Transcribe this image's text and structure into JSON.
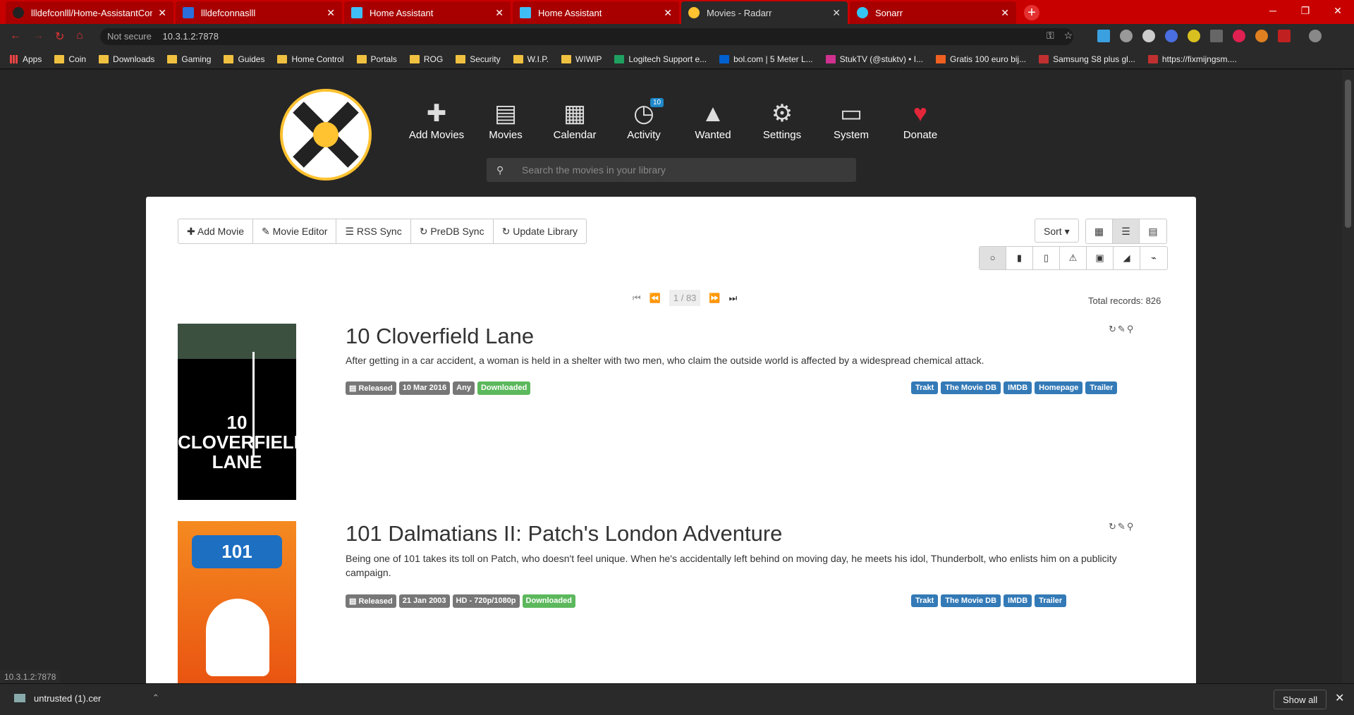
{
  "tabs": [
    {
      "title": "llldefconlll/Home-AssistantConfi",
      "favicon_color": "#222222"
    },
    {
      "title": "llldefconnaslll",
      "favicon_color": "#2a6fdb"
    },
    {
      "title": "Home Assistant",
      "favicon_color": "#41bdf5"
    },
    {
      "title": "Home Assistant",
      "favicon_color": "#41bdf5"
    },
    {
      "title": "Movies - Radarr",
      "favicon_color": "#ffc230"
    },
    {
      "title": "Sonarr",
      "favicon_color": "#35c5f4"
    }
  ],
  "browser": {
    "security": "Not secure",
    "url": "10.3.1.2:7878",
    "status_url": "10.3.1.2:7878"
  },
  "bookmarks": [
    {
      "label": "Apps",
      "kind": "apps"
    },
    {
      "label": "Coin",
      "kind": "folder"
    },
    {
      "label": "Downloads",
      "kind": "folder"
    },
    {
      "label": "Gaming",
      "kind": "folder"
    },
    {
      "label": "Guides",
      "kind": "folder"
    },
    {
      "label": "Home Control",
      "kind": "folder"
    },
    {
      "label": "Portals",
      "kind": "folder"
    },
    {
      "label": "ROG",
      "kind": "folder"
    },
    {
      "label": "Security",
      "kind": "folder"
    },
    {
      "label": "W.I.P.",
      "kind": "folder"
    },
    {
      "label": "WIWIP",
      "kind": "folder"
    },
    {
      "label": "Logitech Support e...",
      "kind": "link"
    },
    {
      "label": "bol.com | 5 Meter L...",
      "kind": "link"
    },
    {
      "label": "StukTV (@stuktv) • I...",
      "kind": "link"
    },
    {
      "label": "Gratis 100 euro bij...",
      "kind": "link"
    },
    {
      "label": "Samsung S8 plus gl...",
      "kind": "link"
    },
    {
      "label": "https://fixmijngsm....",
      "kind": "link"
    }
  ],
  "nav": [
    {
      "label": "Add Movies",
      "icon": "plus-icon",
      "glyph": "✚"
    },
    {
      "label": "Movies",
      "icon": "film-icon",
      "glyph": "🎞"
    },
    {
      "label": "Calendar",
      "icon": "calendar-icon",
      "glyph": "▦"
    },
    {
      "label": "Activity",
      "icon": "clock-icon",
      "glyph": "◷",
      "badge": "10"
    },
    {
      "label": "Wanted",
      "icon": "warning-icon",
      "glyph": "▲"
    },
    {
      "label": "Settings",
      "icon": "gears-icon",
      "glyph": "⚙"
    },
    {
      "label": "System",
      "icon": "laptop-icon",
      "glyph": "▭"
    },
    {
      "label": "Donate",
      "icon": "heart-icon",
      "glyph": "♥"
    }
  ],
  "search": {
    "placeholder": "Search the movies in your library"
  },
  "toolbar": {
    "add_movie": "Add Movie",
    "movie_editor": "Movie Editor",
    "rss_sync": "RSS Sync",
    "predb_sync": "PreDB Sync",
    "update_library": "Update Library",
    "sort": "Sort"
  },
  "pager": {
    "page": "1 / 83",
    "total": "Total records: 826"
  },
  "movies": [
    {
      "title": "10 Cloverfield Lane",
      "overview": "After getting in a car accident, a woman is held in a shelter with two men, who claim the outside world is affected by a widespread chemical attack.",
      "status": "Released",
      "date": "10 Mar 2016",
      "profile": "Any",
      "state": "Downloaded",
      "links": [
        "Trakt",
        "The Movie DB",
        "IMDB",
        "Homepage",
        "Trailer"
      ]
    },
    {
      "title": "101 Dalmatians II: Patch's London Adventure",
      "overview": "Being one of 101 takes its toll on Patch, who doesn't feel unique. When he's accidentally left behind on moving day, he meets his idol, Thunderbolt, who enlists him on a publicity campaign.",
      "status": "Released",
      "date": "21 Jan 2003",
      "profile": "HD - 720p/1080p",
      "state": "Downloaded",
      "links": [
        "Trakt",
        "The Movie DB",
        "IMDB",
        "Trailer"
      ]
    }
  ],
  "download": {
    "file": "untrusted (1).cer",
    "show_all": "Show all"
  },
  "colors": {
    "accent": "#ffc230",
    "tabbar": "#c90000",
    "link": "#337ab7",
    "success": "#5cb85c"
  }
}
